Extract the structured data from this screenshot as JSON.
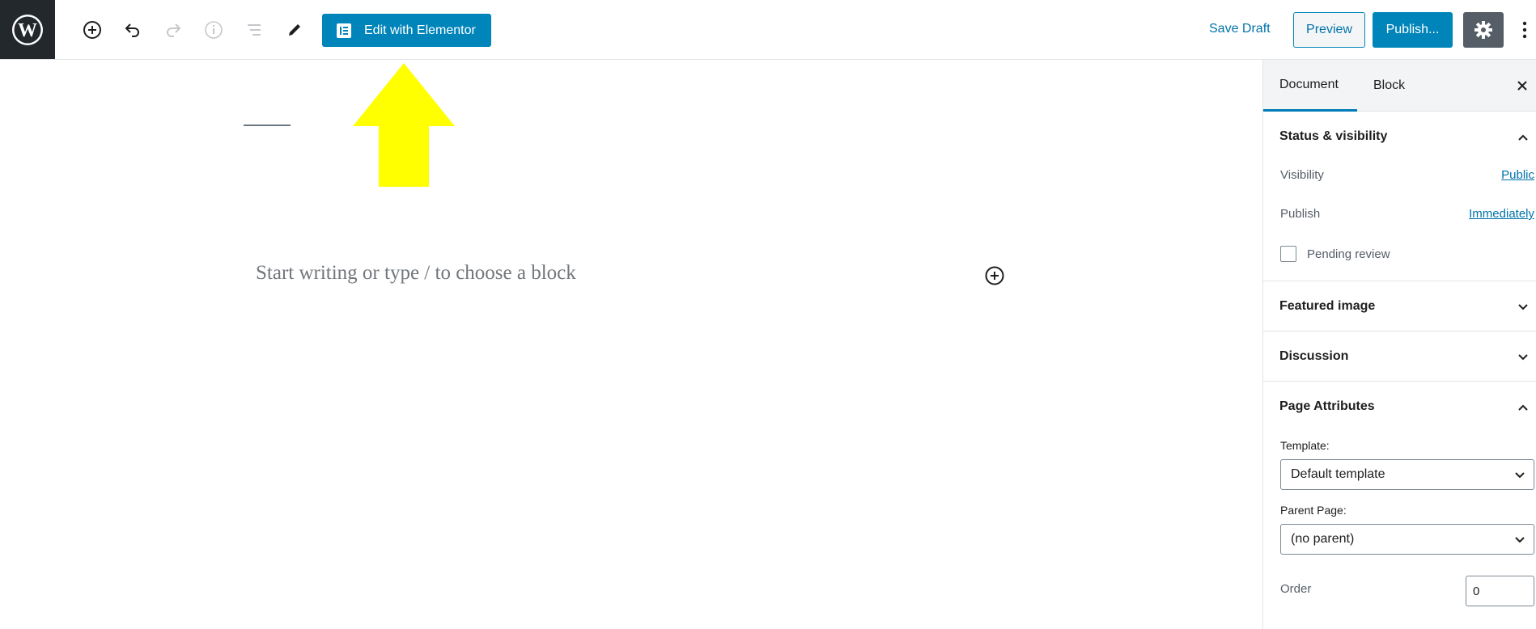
{
  "toolbar": {
    "edit_with_elementor": "Edit with Elementor",
    "save_draft": "Save Draft",
    "preview": "Preview",
    "publish": "Publish..."
  },
  "editor": {
    "placeholder": "Start writing or type / to choose a block"
  },
  "sidebar": {
    "tabs": [
      "Document",
      "Block"
    ],
    "status_visibility": {
      "title": "Status & visibility",
      "visibility_label": "Visibility",
      "visibility_value": "Public",
      "publish_label": "Publish",
      "publish_value": "Immediately",
      "pending_review": "Pending review"
    },
    "featured_image": "Featured image",
    "discussion": "Discussion",
    "page_attributes": {
      "title": "Page Attributes",
      "template_label": "Template:",
      "template_value": "Default template",
      "parent_label": "Parent Page:",
      "parent_value": "(no parent)",
      "order_label": "Order",
      "order_value": "0"
    }
  },
  "colors": {
    "primary": "#0085ba",
    "link": "#0073aa",
    "dark": "#23282d",
    "settings_bg": "#555d66",
    "annotation_arrow": "#ffff00"
  }
}
